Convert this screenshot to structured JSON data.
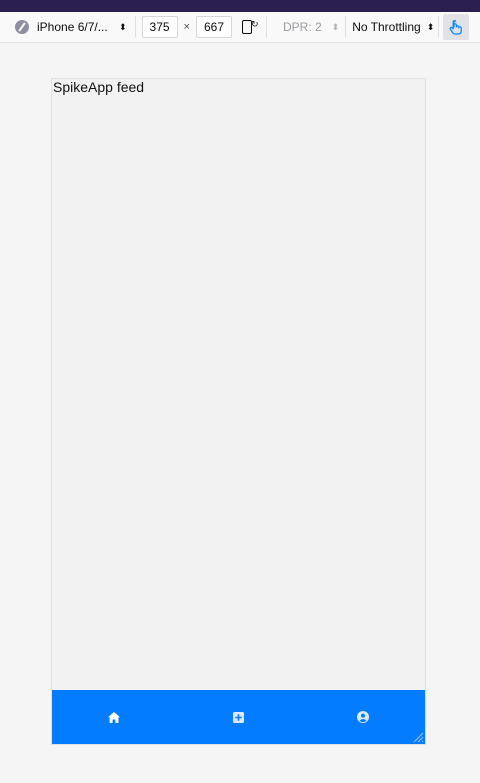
{
  "toolbar": {
    "device_name": "iPhone 6/7/...",
    "width_value": "375",
    "times": "×",
    "height_value": "667",
    "dpr_label": "DPR: 2",
    "throttle_label": "No Throttling"
  },
  "app": {
    "title": "SpikeApp feed",
    "nav": {
      "color": "#047cff",
      "items": [
        {
          "icon": "home-icon"
        },
        {
          "icon": "plus-square-icon"
        },
        {
          "icon": "user-circle-icon"
        }
      ]
    }
  }
}
